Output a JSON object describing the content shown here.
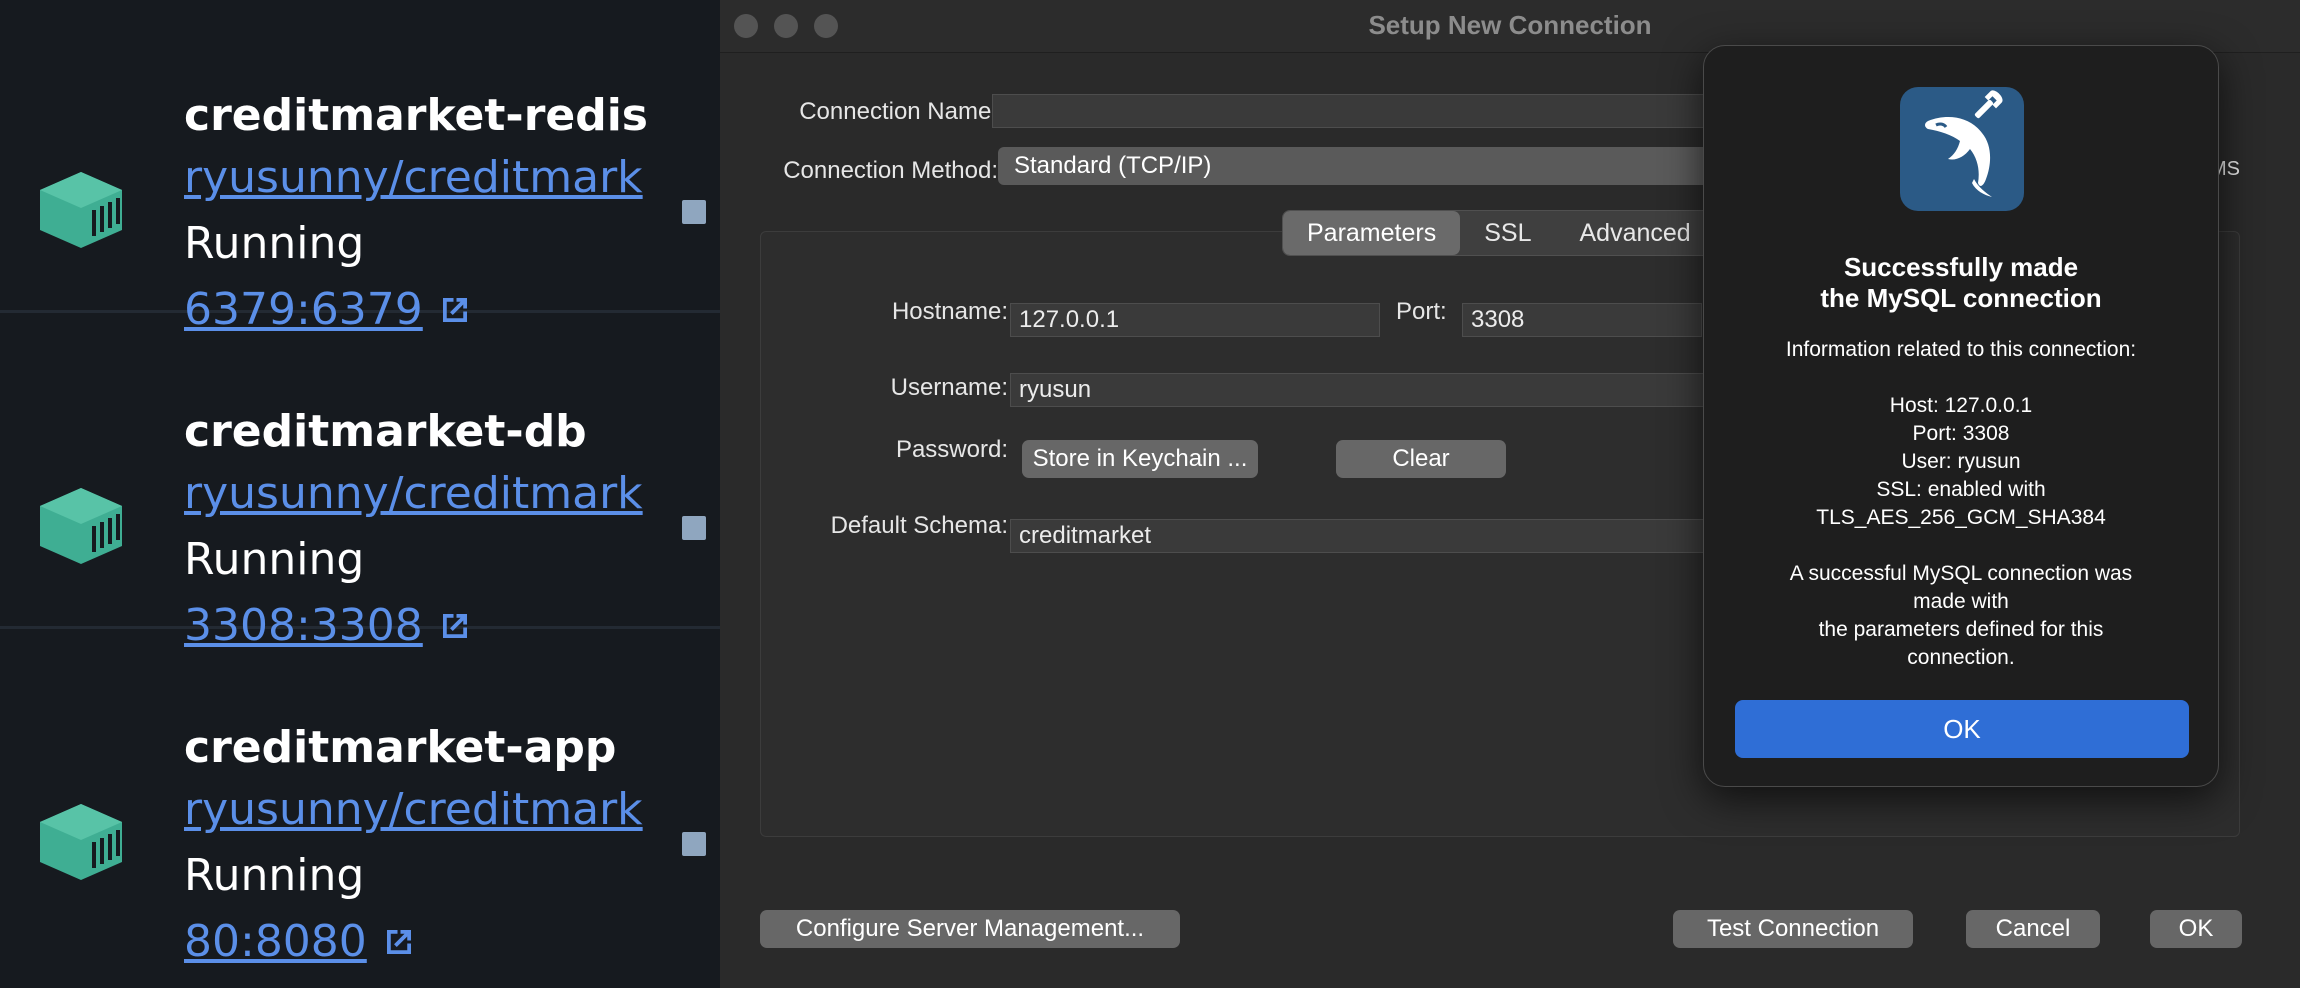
{
  "containers": [
    {
      "name": "creditmarket-redis",
      "image": "ryusunny/creditmark",
      "status": "Running",
      "ports": "6379:6379"
    },
    {
      "name": "creditmarket-db",
      "image": "ryusunny/creditmark",
      "status": "Running",
      "ports": "3308:3308"
    },
    {
      "name": "creditmarket-app",
      "image": "ryusunny/creditmark",
      "status": "Running",
      "ports": "80:8080"
    }
  ],
  "window": {
    "title": "Setup New Connection"
  },
  "form": {
    "connection_name_label": "Connection Name:",
    "connection_name_value": "",
    "connection_method_label": "Connection Method:",
    "connection_method_value": "Standard (TCP/IP)",
    "connection_method_hint": "MS",
    "tabs": [
      "Parameters",
      "SSL",
      "Advanced"
    ],
    "hostname_label": "Hostname:",
    "hostname_value": "127.0.0.1",
    "port_label": "Port:",
    "port_value": "3308",
    "username_label": "Username:",
    "username_value": "ryusun",
    "password_label": "Password:",
    "store_keychain_label": "Store in Keychain ...",
    "clear_label": "Clear",
    "default_schema_label": "Default Schema:",
    "default_schema_value": "creditmarket"
  },
  "footer": {
    "configure_label": "Configure Server Management...",
    "test_label": "Test Connection",
    "cancel_label": "Cancel",
    "ok_label": "OK"
  },
  "popup": {
    "title": "Successfully made\nthe MySQL connection",
    "info": "Information related to this connection:\n\nHost: 127.0.0.1\nPort: 3308\nUser: ryusun\nSSL: enabled with\nTLS_AES_256_GCM_SHA384\n\nA successful MySQL connection was\nmade with\nthe parameters defined for this\nconnection.",
    "ok_label": "OK"
  },
  "colors": {
    "accent": "#2f6ed6",
    "link": "#5b8fe8",
    "docker_cube": "#3fae93"
  }
}
